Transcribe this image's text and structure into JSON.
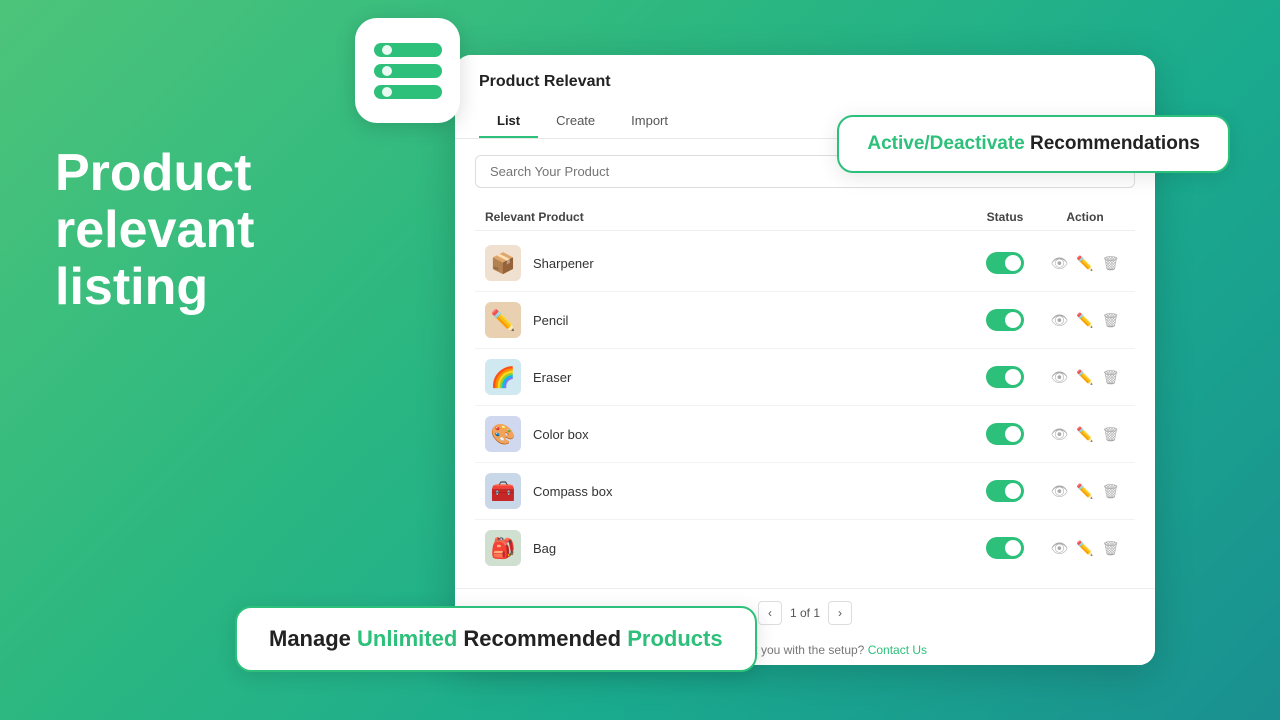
{
  "background": {
    "gradient_start": "#4dc47a",
    "gradient_end": "#1a9090"
  },
  "left_text": {
    "line1": "Product",
    "line2": "relevant",
    "line3": "listing"
  },
  "app_icon": {
    "alt": "List icon with bars"
  },
  "callout_top": {
    "green_part": "Active/Deactivate",
    "bold_part": " Recommendations"
  },
  "callout_bottom": {
    "manage": "Manage ",
    "unlimited": "Unlimited",
    "recommended": " Recommended ",
    "products": "Products"
  },
  "panel": {
    "title": "Product Relevant",
    "tabs": [
      {
        "label": "List",
        "active": true
      },
      {
        "label": "Create",
        "active": false
      },
      {
        "label": "Import",
        "active": false
      }
    ],
    "search_placeholder": "Search Your Product",
    "table": {
      "col_product": "Relevant Product",
      "col_status": "Status",
      "col_action": "Action"
    },
    "products": [
      {
        "name": "Sharpener",
        "emoji": "📦",
        "color_class": "prod-sharpener",
        "enabled": true
      },
      {
        "name": "Pencil",
        "emoji": "✏️",
        "color_class": "prod-pencil",
        "enabled": true
      },
      {
        "name": "Eraser",
        "emoji": "🌈",
        "color_class": "prod-eraser",
        "enabled": true
      },
      {
        "name": "Color box",
        "emoji": "🎨",
        "color_class": "prod-colorbox",
        "enabled": true
      },
      {
        "name": "Compass box",
        "emoji": "🧰",
        "color_class": "prod-compassbox",
        "enabled": true
      },
      {
        "name": "Bag",
        "emoji": "🎒",
        "color_class": "prod-bag",
        "enabled": true
      }
    ],
    "pagination": {
      "current": "1 of 1"
    },
    "help_text": "Can we assist you with the setup?",
    "help_link": "Contact Us"
  }
}
